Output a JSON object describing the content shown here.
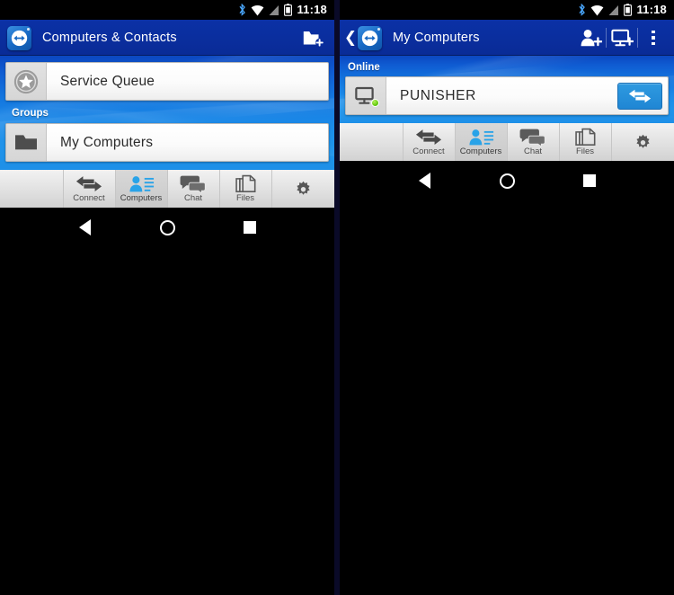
{
  "statusbar": {
    "time": "11:18",
    "icons": [
      "bluetooth-icon",
      "wifi-icon",
      "cellular-signal-icon",
      "battery-icon"
    ]
  },
  "left_screen": {
    "appbar": {
      "logo": "teamviewer-logo-icon",
      "title": "Computers & Contacts",
      "action_icon": "add-folder-icon"
    },
    "items": [
      {
        "icon": "service-queue-star-icon",
        "label": "Service Queue"
      }
    ],
    "group_header": "Groups",
    "groups": [
      {
        "icon": "folder-icon",
        "label": "My Computers"
      }
    ]
  },
  "right_screen": {
    "appbar": {
      "back": "back-chevron-icon",
      "logo": "teamviewer-logo-icon",
      "title": "My Computers",
      "actions": [
        "add-contact-icon",
        "add-computer-icon",
        "overflow-menu-icon"
      ]
    },
    "section_header": "Online",
    "computers": [
      {
        "icon": "computer-monitor-icon",
        "status": "online",
        "name": "PUNISHER",
        "action": "connect-arrows-icon"
      }
    ]
  },
  "tabbar": {
    "tabs": [
      {
        "label": "Connect",
        "icon": "connect-arrows-icon",
        "selected": false
      },
      {
        "label": "Computers",
        "icon": "computers-contacts-icon",
        "selected": true
      },
      {
        "label": "Chat",
        "icon": "chat-bubbles-icon",
        "selected": false
      },
      {
        "label": "Files",
        "icon": "files-icon",
        "selected": false
      }
    ],
    "settings_icon": "gear-icon"
  },
  "navbar": {
    "buttons": [
      "back-nav-button",
      "home-nav-button",
      "recents-nav-button"
    ]
  },
  "colors": {
    "appbar_blue": "#0a2ea0",
    "wallpaper_top": "#0b47c0",
    "wallpaper_bottom": "#1e90e8",
    "accent_blue": "#1f86d4",
    "online_green": "#66cc11",
    "tab_selected_icon": "#29a3e8"
  }
}
